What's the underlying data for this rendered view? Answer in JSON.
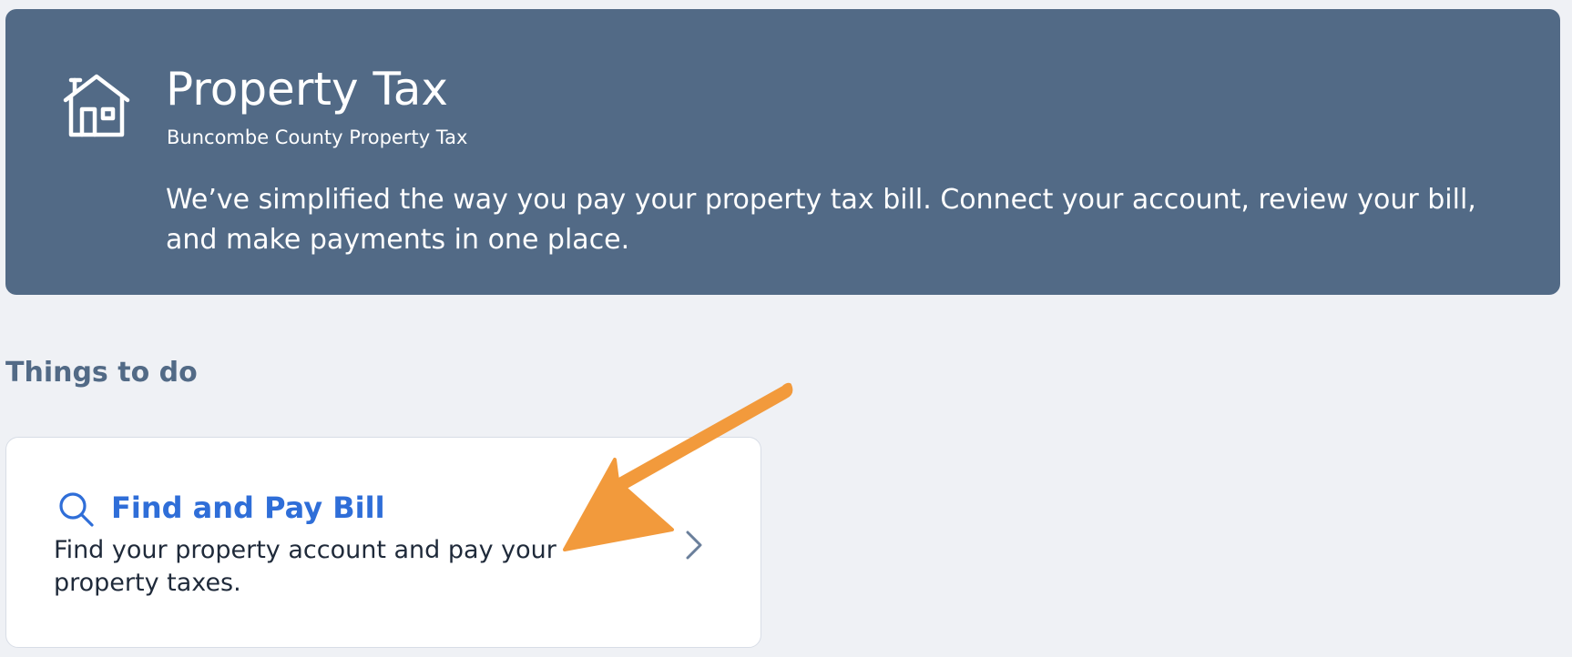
{
  "hero": {
    "title": "Property Tax",
    "subtitle": "Buncombe County Property Tax",
    "description": "We’ve simplified the way you pay your property tax bill. Connect your account, review your bill, and make payments in one place.",
    "icon": "house-icon",
    "background_color": "#526a86"
  },
  "things_to_do": {
    "heading": "Things to do",
    "tasks": [
      {
        "title": "Find and Pay Bill",
        "description": "Find your property account and pay your property taxes.",
        "icon": "search-icon",
        "title_color": "#2f6ed8"
      }
    ]
  },
  "annotation": {
    "type": "arrow",
    "color": "#f29a3c"
  }
}
